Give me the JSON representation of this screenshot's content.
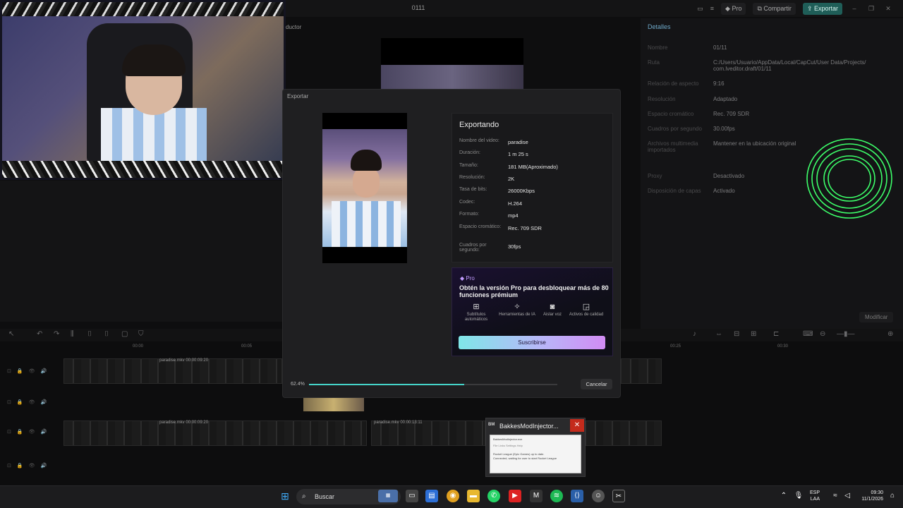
{
  "titlebar": {
    "title": "0111",
    "pro_label": "Pro",
    "share_label": "Compartir",
    "export_label": "Exportar"
  },
  "editor": {
    "productor_label": "ductor",
    "toolbar_icons": [
      "select-icon",
      "undo-icon",
      "redo-icon",
      "split-icon",
      "split-left-icon",
      "split-right-icon",
      "delete-icon",
      "shield-icon"
    ]
  },
  "details": {
    "title": "Detalles",
    "rows": [
      {
        "label": "Nombre",
        "value": "01/11"
      },
      {
        "label": "Ruta",
        "value": "C:/Users/Usuario/AppData/Local/CapCut/User Data/Projects/\ncom.lveditor.draft/01/11"
      },
      {
        "label": "Relación de aspecto",
        "value": "9:16"
      },
      {
        "label": "Resolución",
        "value": "Adaptado"
      },
      {
        "label": "Espacio cromático",
        "value": "Rec. 709 SDR"
      },
      {
        "label": "Cuadros por segundo",
        "value": "30.00fps"
      },
      {
        "label": "Archivos multimedia importados",
        "value": "Mantener en la ubicación original"
      },
      {
        "label": "Proxy",
        "value": "Desactivado"
      },
      {
        "label": "Disposición de capas",
        "value": "Activado"
      }
    ],
    "modify_label": "Modificar"
  },
  "timeline": {
    "tracks": [
      {
        "label": "paradise.mkv  00:00:09:20"
      },
      {
        "label": "paradise.mkv  00:00:09:20"
      },
      {
        "label": "paradise.mkv  00:00:13:11"
      }
    ],
    "ruler": [
      "00:00",
      "00:05",
      "00:25",
      "00:30"
    ]
  },
  "export_dialog": {
    "title": "Exportar",
    "status_title": "Exportando",
    "info": [
      {
        "label": "Nombre del video:",
        "value": "paradise"
      },
      {
        "label": "Duración:",
        "value": "1 m 25 s"
      },
      {
        "label": "Tamaño:",
        "value": "181 MB(Aproximado)"
      },
      {
        "label": "Resolución:",
        "value": "2K"
      },
      {
        "label": "Tasa de bits:",
        "value": "26000Kbps"
      },
      {
        "label": "Codec:",
        "value": "H.264"
      },
      {
        "label": "Formato:",
        "value": "mp4"
      },
      {
        "label": "Espacio cromático:",
        "value": "Rec. 709 SDR"
      },
      {
        "label": "Cuadros por segundo:",
        "value": "30fps"
      }
    ],
    "pro": {
      "badge": "Pro",
      "headline": "Obtén la versión Pro para desbloquear más de 80 funciones prémium",
      "features": [
        {
          "label": "Subtítulos automáticos",
          "icon": "subtitles-icon"
        },
        {
          "label": "Herramientas de IA",
          "icon": "ai-tools-icon"
        },
        {
          "label": "Aislar voz",
          "icon": "isolate-voice-icon"
        },
        {
          "label": "Activos de calidad",
          "icon": "quality-assets-icon"
        }
      ],
      "subscribe_label": "Suscribirse"
    },
    "progress_text": "62.4%",
    "progress": 0.624,
    "cancel_label": "Cancelar"
  },
  "popup": {
    "badge": "BM",
    "title": "BakkesModInjector...",
    "thumb_title": "BakkesModInjector.exe",
    "thumb_menu": "File   Links   Settings   Help",
    "thumb_line1": "Rocket League (Epic Games) up to date.",
    "thumb_line2": "Connected, waiting for user to start Rocket League"
  },
  "taskbar": {
    "search_placeholder": "Buscar",
    "lang_line1": "ESP",
    "lang_line2": "LAA",
    "time": "09:30",
    "date": "11/1/2026"
  },
  "colors": {
    "accent": "#45d4c9",
    "export_button": "#1f5e58",
    "close_red": "#c42b1c",
    "rings": "#3dff6a"
  }
}
